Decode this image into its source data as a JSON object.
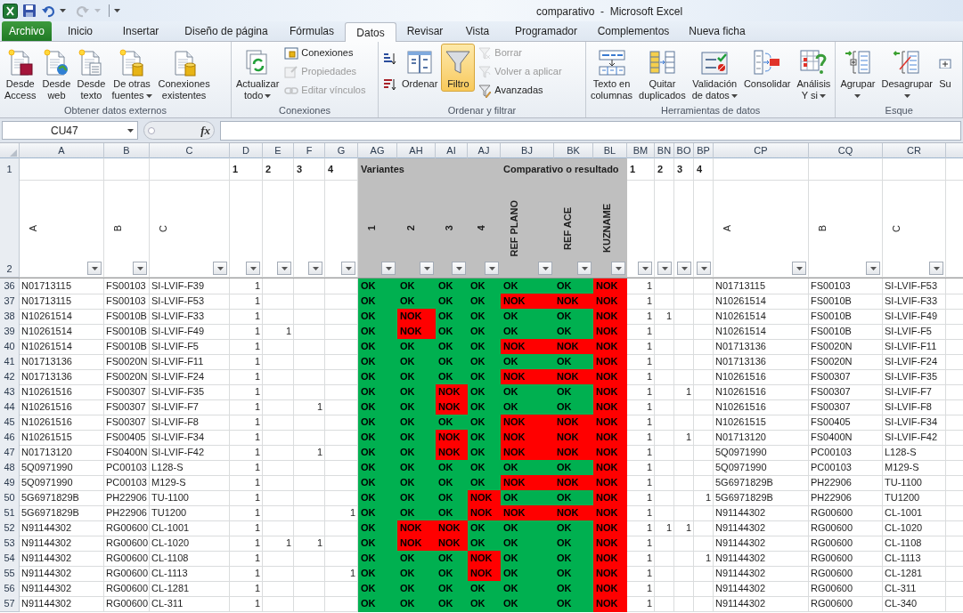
{
  "title_bar": {
    "title": "comparativo  -  Microsoft Excel"
  },
  "ribbon": {
    "tabs": [
      {
        "label": "Archivo",
        "kind": "file",
        "selected": false
      },
      {
        "label": "Inicio",
        "kind": "tab",
        "selected": false
      },
      {
        "label": "Insertar",
        "kind": "tab",
        "selected": false
      },
      {
        "label": "Diseño de página",
        "kind": "tab",
        "selected": false
      },
      {
        "label": "Fórmulas",
        "kind": "tab",
        "selected": false
      },
      {
        "label": "Datos",
        "kind": "tab",
        "selected": true
      },
      {
        "label": "Revisar",
        "kind": "tab",
        "selected": false
      },
      {
        "label": "Vista",
        "kind": "tab",
        "selected": false
      },
      {
        "label": "Programador",
        "kind": "tab",
        "selected": false
      },
      {
        "label": "Complementos",
        "kind": "tab",
        "selected": false
      },
      {
        "label": "Nueva ficha",
        "kind": "tab",
        "selected": false
      }
    ],
    "groups": [
      {
        "label": "Obtener datos externos",
        "commands": [
          {
            "kind": "large",
            "lines": [
              "Desde",
              "Access"
            ],
            "dropdown": false,
            "disabled": false,
            "on": false
          },
          {
            "kind": "large",
            "lines": [
              "Desde",
              "web"
            ],
            "dropdown": false,
            "disabled": false,
            "on": false
          },
          {
            "kind": "large",
            "lines": [
              "Desde",
              "texto"
            ],
            "dropdown": false,
            "disabled": false,
            "on": false
          },
          {
            "kind": "large",
            "lines": [
              "De otras",
              "fuentes"
            ],
            "dropdown": true,
            "disabled": false,
            "on": false
          },
          {
            "kind": "large",
            "lines": [
              "Conexiones",
              "existentes"
            ],
            "dropdown": false,
            "disabled": false,
            "on": false
          }
        ]
      },
      {
        "label": "Conexiones",
        "commands": [
          {
            "kind": "large",
            "lines": [
              "Actualizar",
              "todo"
            ],
            "dropdown": true,
            "disabled": false,
            "on": false
          },
          {
            "kind": "small",
            "lines": [
              "Conexiones"
            ],
            "dropdown": false,
            "disabled": false,
            "on": false
          },
          {
            "kind": "small",
            "lines": [
              "Propiedades"
            ],
            "dropdown": false,
            "disabled": true,
            "on": false
          },
          {
            "kind": "small",
            "lines": [
              "Editar vínculos"
            ],
            "dropdown": false,
            "disabled": true,
            "on": false
          }
        ]
      },
      {
        "label": "Ordenar y filtrar",
        "commands": [
          {
            "kind": "icon",
            "dropdown": false,
            "disabled": false,
            "on": false
          },
          {
            "kind": "icon",
            "dropdown": false,
            "disabled": false,
            "on": false
          },
          {
            "kind": "large",
            "lines": [
              "Ordenar"
            ],
            "dropdown": false,
            "disabled": false,
            "on": false
          },
          {
            "kind": "large",
            "lines": [
              "Filtro"
            ],
            "dropdown": false,
            "disabled": false,
            "on": true
          },
          {
            "kind": "small",
            "lines": [
              "Borrar"
            ],
            "dropdown": false,
            "disabled": true,
            "on": false
          },
          {
            "kind": "small",
            "lines": [
              "Volver a aplicar"
            ],
            "dropdown": false,
            "disabled": true,
            "on": false
          },
          {
            "kind": "small",
            "lines": [
              "Avanzadas"
            ],
            "dropdown": false,
            "disabled": false,
            "on": false
          }
        ]
      },
      {
        "label": "Herramientas de datos",
        "commands": [
          {
            "kind": "large",
            "lines": [
              "Texto en",
              "columnas"
            ],
            "dropdown": false,
            "disabled": false,
            "on": false
          },
          {
            "kind": "large",
            "lines": [
              "Quitar",
              "duplicados"
            ],
            "dropdown": false,
            "disabled": false,
            "on": false
          },
          {
            "kind": "large",
            "lines": [
              "Validación",
              "de datos"
            ],
            "dropdown": true,
            "disabled": false,
            "on": false
          },
          {
            "kind": "large",
            "lines": [
              "Consolidar"
            ],
            "dropdown": false,
            "disabled": false,
            "on": false
          },
          {
            "kind": "large",
            "lines": [
              "Análisis",
              "Y si"
            ],
            "dropdown": true,
            "disabled": false,
            "on": false
          }
        ]
      },
      {
        "label": "Esque",
        "commands": [
          {
            "kind": "large",
            "lines": [
              "Agrupar"
            ],
            "dropdown": true,
            "disabled": false,
            "on": false
          },
          {
            "kind": "large",
            "lines": [
              "Desagrupar"
            ],
            "dropdown": true,
            "disabled": false,
            "on": false
          },
          {
            "kind": "large",
            "lines": [
              "Su"
            ],
            "dropdown": false,
            "disabled": false,
            "on": false
          }
        ]
      }
    ]
  },
  "formula_bar": {
    "name_box": "CU47",
    "function_button": "fx"
  },
  "sheet": {
    "row1": "1",
    "row2": "2",
    "columns": [
      {
        "letter": "A",
        "label": "A",
        "shaded": false
      },
      {
        "letter": "B",
        "label": "B",
        "shaded": false
      },
      {
        "letter": "C",
        "label": "C",
        "shaded": false
      },
      {
        "letter": "D",
        "group": "1",
        "shaded": false
      },
      {
        "letter": "E",
        "group": "2",
        "shaded": false
      },
      {
        "letter": "F",
        "group": "3",
        "shaded": false
      },
      {
        "letter": "G",
        "group": "4",
        "shaded": false
      },
      {
        "letter": "AG",
        "group": "Variantes",
        "label": "1",
        "shaded": true
      },
      {
        "letter": "AH",
        "label": "2",
        "shaded": true
      },
      {
        "letter": "AI",
        "label": "3",
        "shaded": true
      },
      {
        "letter": "AJ",
        "label": "4",
        "shaded": true
      },
      {
        "letter": "BJ",
        "group": "Comparativo o resultado",
        "label": "REF PLANO",
        "shaded": true
      },
      {
        "letter": "BK",
        "label": "REF ACE",
        "shaded": true
      },
      {
        "letter": "BL",
        "label": "KUZNAME",
        "shaded": true
      },
      {
        "letter": "BM",
        "group": "1",
        "shaded": false
      },
      {
        "letter": "BN",
        "group": "2",
        "shaded": false
      },
      {
        "letter": "BO",
        "group": "3",
        "shaded": false
      },
      {
        "letter": "BP",
        "group": "4",
        "shaded": false
      },
      {
        "letter": "CP",
        "label": "A",
        "shaded": false
      },
      {
        "letter": "CQ",
        "label": "B",
        "shaded": false
      },
      {
        "letter": "CR",
        "label": "C",
        "shaded": false
      }
    ],
    "rows": [
      {
        "num": "36",
        "a": "N01713115",
        "b": "FS00103",
        "c": "SI-LVIF-F39",
        "d": "1",
        "ag": {
          "text": "OK",
          "color": "#00b050"
        },
        "ah": {
          "text": "OK",
          "color": "#00b050"
        },
        "ai": {
          "text": "OK",
          "color": "#00b050"
        },
        "aj": {
          "text": "OK",
          "color": "#00b050"
        },
        "bj": {
          "text": "OK",
          "color": "#00b050"
        },
        "bk": {
          "text": "OK",
          "color": "#00b050"
        },
        "bl": {
          "text": "NOK",
          "color": "#ff0000"
        },
        "bm": "1",
        "cp": "N01713115",
        "cq": "FS00103",
        "cr": "SI-LVIF-F53"
      },
      {
        "num": "37",
        "a": "N01713115",
        "b": "FS00103",
        "c": "SI-LVIF-F53",
        "d": "1",
        "ag": {
          "text": "OK",
          "color": "#00b050"
        },
        "ah": {
          "text": "OK",
          "color": "#00b050"
        },
        "ai": {
          "text": "OK",
          "color": "#00b050"
        },
        "aj": {
          "text": "OK",
          "color": "#00b050"
        },
        "bj": {
          "text": "NOK",
          "color": "#ff0000"
        },
        "bk": {
          "text": "NOK",
          "color": "#ff0000"
        },
        "bl": {
          "text": "NOK",
          "color": "#ff0000"
        },
        "bm": "1",
        "cp": "N10261514",
        "cq": "FS0010B",
        "cr": "SI-LVIF-F33"
      },
      {
        "num": "38",
        "a": "N10261514",
        "b": "FS0010B",
        "c": "SI-LVIF-F33",
        "d": "1",
        "ag": {
          "text": "OK",
          "color": "#00b050"
        },
        "ah": {
          "text": "NOK",
          "color": "#ff0000"
        },
        "ai": {
          "text": "OK",
          "color": "#00b050"
        },
        "aj": {
          "text": "OK",
          "color": "#00b050"
        },
        "bj": {
          "text": "OK",
          "color": "#00b050"
        },
        "bk": {
          "text": "OK",
          "color": "#00b050"
        },
        "bl": {
          "text": "NOK",
          "color": "#ff0000"
        },
        "bm": "1",
        "bn": "1",
        "cp": "N10261514",
        "cq": "FS0010B",
        "cr": "SI-LVIF-F49"
      },
      {
        "num": "39",
        "a": "N10261514",
        "b": "FS0010B",
        "c": "SI-LVIF-F49",
        "d": "1",
        "e": "1",
        "ag": {
          "text": "OK",
          "color": "#00b050"
        },
        "ah": {
          "text": "NOK",
          "color": "#ff0000"
        },
        "ai": {
          "text": "OK",
          "color": "#00b050"
        },
        "aj": {
          "text": "OK",
          "color": "#00b050"
        },
        "bj": {
          "text": "OK",
          "color": "#00b050"
        },
        "bk": {
          "text": "OK",
          "color": "#00b050"
        },
        "bl": {
          "text": "NOK",
          "color": "#ff0000"
        },
        "bm": "1",
        "cp": "N10261514",
        "cq": "FS0010B",
        "cr": "SI-LVIF-F5"
      },
      {
        "num": "40",
        "a": "N10261514",
        "b": "FS0010B",
        "c": "SI-LVIF-F5",
        "d": "1",
        "ag": {
          "text": "OK",
          "color": "#00b050"
        },
        "ah": {
          "text": "OK",
          "color": "#00b050"
        },
        "ai": {
          "text": "OK",
          "color": "#00b050"
        },
        "aj": {
          "text": "OK",
          "color": "#00b050"
        },
        "bj": {
          "text": "NOK",
          "color": "#ff0000"
        },
        "bk": {
          "text": "NOK",
          "color": "#ff0000"
        },
        "bl": {
          "text": "NOK",
          "color": "#ff0000"
        },
        "bm": "1",
        "cp": "N01713136",
        "cq": "FS0020N",
        "cr": "SI-LVIF-F11"
      },
      {
        "num": "41",
        "a": "N01713136",
        "b": "FS0020N",
        "c": "SI-LVIF-F11",
        "d": "1",
        "ag": {
          "text": "OK",
          "color": "#00b050"
        },
        "ah": {
          "text": "OK",
          "color": "#00b050"
        },
        "ai": {
          "text": "OK",
          "color": "#00b050"
        },
        "aj": {
          "text": "OK",
          "color": "#00b050"
        },
        "bj": {
          "text": "OK",
          "color": "#00b050"
        },
        "bk": {
          "text": "OK",
          "color": "#00b050"
        },
        "bl": {
          "text": "NOK",
          "color": "#ff0000"
        },
        "bm": "1",
        "cp": "N01713136",
        "cq": "FS0020N",
        "cr": "SI-LVIF-F24"
      },
      {
        "num": "42",
        "a": "N01713136",
        "b": "FS0020N",
        "c": "SI-LVIF-F24",
        "d": "1",
        "ag": {
          "text": "OK",
          "color": "#00b050"
        },
        "ah": {
          "text": "OK",
          "color": "#00b050"
        },
        "ai": {
          "text": "OK",
          "color": "#00b050"
        },
        "aj": {
          "text": "OK",
          "color": "#00b050"
        },
        "bj": {
          "text": "NOK",
          "color": "#ff0000"
        },
        "bk": {
          "text": "NOK",
          "color": "#ff0000"
        },
        "bl": {
          "text": "NOK",
          "color": "#ff0000"
        },
        "bm": "1",
        "cp": "N10261516",
        "cq": "FS00307",
        "cr": "SI-LVIF-F35"
      },
      {
        "num": "43",
        "a": "N10261516",
        "b": "FS00307",
        "c": "SI-LVIF-F35",
        "d": "1",
        "ag": {
          "text": "OK",
          "color": "#00b050"
        },
        "ah": {
          "text": "OK",
          "color": "#00b050"
        },
        "ai": {
          "text": "NOK",
          "color": "#ff0000"
        },
        "aj": {
          "text": "OK",
          "color": "#00b050"
        },
        "bj": {
          "text": "OK",
          "color": "#00b050"
        },
        "bk": {
          "text": "OK",
          "color": "#00b050"
        },
        "bl": {
          "text": "NOK",
          "color": "#ff0000"
        },
        "bm": "1",
        "bo": "1",
        "cp": "N10261516",
        "cq": "FS00307",
        "cr": "SI-LVIF-F7"
      },
      {
        "num": "44",
        "a": "N10261516",
        "b": "FS00307",
        "c": "SI-LVIF-F7",
        "d": "1",
        "f": "1",
        "ag": {
          "text": "OK",
          "color": "#00b050"
        },
        "ah": {
          "text": "OK",
          "color": "#00b050"
        },
        "ai": {
          "text": "NOK",
          "color": "#ff0000"
        },
        "aj": {
          "text": "OK",
          "color": "#00b050"
        },
        "bj": {
          "text": "OK",
          "color": "#00b050"
        },
        "bk": {
          "text": "OK",
          "color": "#00b050"
        },
        "bl": {
          "text": "NOK",
          "color": "#ff0000"
        },
        "bm": "1",
        "cp": "N10261516",
        "cq": "FS00307",
        "cr": "SI-LVIF-F8"
      },
      {
        "num": "45",
        "a": "N10261516",
        "b": "FS00307",
        "c": "SI-LVIF-F8",
        "d": "1",
        "ag": {
          "text": "OK",
          "color": "#00b050"
        },
        "ah": {
          "text": "OK",
          "color": "#00b050"
        },
        "ai": {
          "text": "OK",
          "color": "#00b050"
        },
        "aj": {
          "text": "OK",
          "color": "#00b050"
        },
        "bj": {
          "text": "NOK",
          "color": "#ff0000"
        },
        "bk": {
          "text": "NOK",
          "color": "#ff0000"
        },
        "bl": {
          "text": "NOK",
          "color": "#ff0000"
        },
        "bm": "1",
        "cp": "N10261515",
        "cq": "FS00405",
        "cr": "SI-LVIF-F34"
      },
      {
        "num": "46",
        "a": "N10261515",
        "b": "FS00405",
        "c": "SI-LVIF-F34",
        "d": "1",
        "ag": {
          "text": "OK",
          "color": "#00b050"
        },
        "ah": {
          "text": "OK",
          "color": "#00b050"
        },
        "ai": {
          "text": "NOK",
          "color": "#ff0000"
        },
        "aj": {
          "text": "OK",
          "color": "#00b050"
        },
        "bj": {
          "text": "NOK",
          "color": "#ff0000"
        },
        "bk": {
          "text": "NOK",
          "color": "#ff0000"
        },
        "bl": {
          "text": "NOK",
          "color": "#ff0000"
        },
        "bm": "1",
        "bo": "1",
        "cp": "N01713120",
        "cq": "FS0400N",
        "cr": "SI-LVIF-F42"
      },
      {
        "num": "47",
        "a": "N01713120",
        "b": "FS0400N",
        "c": "SI-LVIF-F42",
        "d": "1",
        "f": "1",
        "ag": {
          "text": "OK",
          "color": "#00b050"
        },
        "ah": {
          "text": "OK",
          "color": "#00b050"
        },
        "ai": {
          "text": "NOK",
          "color": "#ff0000"
        },
        "aj": {
          "text": "OK",
          "color": "#00b050"
        },
        "bj": {
          "text": "NOK",
          "color": "#ff0000"
        },
        "bk": {
          "text": "NOK",
          "color": "#ff0000"
        },
        "bl": {
          "text": "NOK",
          "color": "#ff0000"
        },
        "bm": "1",
        "cp": "5Q0971990",
        "cq": "PC00103",
        "cr": "L128-S"
      },
      {
        "num": "48",
        "a": "5Q0971990",
        "b": "PC00103",
        "c": "L128-S",
        "d": "1",
        "ag": {
          "text": "OK",
          "color": "#00b050"
        },
        "ah": {
          "text": "OK",
          "color": "#00b050"
        },
        "ai": {
          "text": "OK",
          "color": "#00b050"
        },
        "aj": {
          "text": "OK",
          "color": "#00b050"
        },
        "bj": {
          "text": "OK",
          "color": "#00b050"
        },
        "bk": {
          "text": "OK",
          "color": "#00b050"
        },
        "bl": {
          "text": "NOK",
          "color": "#ff0000"
        },
        "bm": "1",
        "cp": "5Q0971990",
        "cq": "PC00103",
        "cr": "M129-S"
      },
      {
        "num": "49",
        "a": "5Q0971990",
        "b": "PC00103",
        "c": "M129-S",
        "d": "1",
        "ag": {
          "text": "OK",
          "color": "#00b050"
        },
        "ah": {
          "text": "OK",
          "color": "#00b050"
        },
        "ai": {
          "text": "OK",
          "color": "#00b050"
        },
        "aj": {
          "text": "OK",
          "color": "#00b050"
        },
        "bj": {
          "text": "NOK",
          "color": "#ff0000"
        },
        "bk": {
          "text": "NOK",
          "color": "#ff0000"
        },
        "bl": {
          "text": "NOK",
          "color": "#ff0000"
        },
        "bm": "1",
        "cp": "5G6971829B",
        "cq": "PH22906",
        "cr": "TU-1100"
      },
      {
        "num": "50",
        "a": "5G6971829B",
        "b": "PH22906",
        "c": "TU-1100",
        "d": "1",
        "ag": {
          "text": "OK",
          "color": "#00b050"
        },
        "ah": {
          "text": "OK",
          "color": "#00b050"
        },
        "ai": {
          "text": "OK",
          "color": "#00b050"
        },
        "aj": {
          "text": "NOK",
          "color": "#ff0000"
        },
        "bj": {
          "text": "OK",
          "color": "#00b050"
        },
        "bk": {
          "text": "OK",
          "color": "#00b050"
        },
        "bl": {
          "text": "NOK",
          "color": "#ff0000"
        },
        "bm": "1",
        "bp": "1",
        "cp": "5G6971829B",
        "cq": "PH22906",
        "cr": "TU1200"
      },
      {
        "num": "51",
        "a": "5G6971829B",
        "b": "PH22906",
        "c": "TU1200",
        "d": "1",
        "g": "1",
        "ag": {
          "text": "OK",
          "color": "#00b050"
        },
        "ah": {
          "text": "OK",
          "color": "#00b050"
        },
        "ai": {
          "text": "OK",
          "color": "#00b050"
        },
        "aj": {
          "text": "NOK",
          "color": "#ff0000"
        },
        "bj": {
          "text": "NOK",
          "color": "#ff0000"
        },
        "bk": {
          "text": "NOK",
          "color": "#ff0000"
        },
        "bl": {
          "text": "NOK",
          "color": "#ff0000"
        },
        "bm": "1",
        "cp": "N91144302",
        "cq": "RG00600",
        "cr": "CL-1001"
      },
      {
        "num": "52",
        "a": "N91144302",
        "b": "RG00600",
        "c": "CL-1001",
        "d": "1",
        "ag": {
          "text": "OK",
          "color": "#00b050"
        },
        "ah": {
          "text": "NOK",
          "color": "#ff0000"
        },
        "ai": {
          "text": "NOK",
          "color": "#ff0000"
        },
        "aj": {
          "text": "OK",
          "color": "#00b050"
        },
        "bj": {
          "text": "OK",
          "color": "#00b050"
        },
        "bk": {
          "text": "OK",
          "color": "#00b050"
        },
        "bl": {
          "text": "NOK",
          "color": "#ff0000"
        },
        "bm": "1",
        "bn": "1",
        "bo": "1",
        "cp": "N91144302",
        "cq": "RG00600",
        "cr": "CL-1020"
      },
      {
        "num": "53",
        "a": "N91144302",
        "b": "RG00600",
        "c": "CL-1020",
        "d": "1",
        "e": "1",
        "f": "1",
        "ag": {
          "text": "OK",
          "color": "#00b050"
        },
        "ah": {
          "text": "NOK",
          "color": "#ff0000"
        },
        "ai": {
          "text": "NOK",
          "color": "#ff0000"
        },
        "aj": {
          "text": "OK",
          "color": "#00b050"
        },
        "bj": {
          "text": "OK",
          "color": "#00b050"
        },
        "bk": {
          "text": "OK",
          "color": "#00b050"
        },
        "bl": {
          "text": "NOK",
          "color": "#ff0000"
        },
        "bm": "1",
        "cp": "N91144302",
        "cq": "RG00600",
        "cr": "CL-1108"
      },
      {
        "num": "54",
        "a": "N91144302",
        "b": "RG00600",
        "c": "CL-1108",
        "d": "1",
        "ag": {
          "text": "OK",
          "color": "#00b050"
        },
        "ah": {
          "text": "OK",
          "color": "#00b050"
        },
        "ai": {
          "text": "OK",
          "color": "#00b050"
        },
        "aj": {
          "text": "NOK",
          "color": "#ff0000"
        },
        "bj": {
          "text": "OK",
          "color": "#00b050"
        },
        "bk": {
          "text": "OK",
          "color": "#00b050"
        },
        "bl": {
          "text": "NOK",
          "color": "#ff0000"
        },
        "bm": "1",
        "bp": "1",
        "cp": "N91144302",
        "cq": "RG00600",
        "cr": "CL-1113"
      },
      {
        "num": "55",
        "a": "N91144302",
        "b": "RG00600",
        "c": "CL-1113",
        "d": "1",
        "g": "1",
        "ag": {
          "text": "OK",
          "color": "#00b050"
        },
        "ah": {
          "text": "OK",
          "color": "#00b050"
        },
        "ai": {
          "text": "OK",
          "color": "#00b050"
        },
        "aj": {
          "text": "NOK",
          "color": "#ff0000"
        },
        "bj": {
          "text": "OK",
          "color": "#00b050"
        },
        "bk": {
          "text": "OK",
          "color": "#00b050"
        },
        "bl": {
          "text": "NOK",
          "color": "#ff0000"
        },
        "bm": "1",
        "cp": "N91144302",
        "cq": "RG00600",
        "cr": "CL-1281"
      },
      {
        "num": "56",
        "a": "N91144302",
        "b": "RG00600",
        "c": "CL-1281",
        "d": "1",
        "ag": {
          "text": "OK",
          "color": "#00b050"
        },
        "ah": {
          "text": "OK",
          "color": "#00b050"
        },
        "ai": {
          "text": "OK",
          "color": "#00b050"
        },
        "aj": {
          "text": "OK",
          "color": "#00b050"
        },
        "bj": {
          "text": "OK",
          "color": "#00b050"
        },
        "bk": {
          "text": "OK",
          "color": "#00b050"
        },
        "bl": {
          "text": "NOK",
          "color": "#ff0000"
        },
        "bm": "1",
        "cp": "N91144302",
        "cq": "RG00600",
        "cr": "CL-311"
      },
      {
        "num": "57",
        "a": "N91144302",
        "b": "RG00600",
        "c": "CL-311",
        "d": "1",
        "ag": {
          "text": "OK",
          "color": "#00b050"
        },
        "ah": {
          "text": "OK",
          "color": "#00b050"
        },
        "ai": {
          "text": "OK",
          "color": "#00b050"
        },
        "aj": {
          "text": "OK",
          "color": "#00b050"
        },
        "bj": {
          "text": "OK",
          "color": "#00b050"
        },
        "bk": {
          "text": "OK",
          "color": "#00b050"
        },
        "bl": {
          "text": "NOK",
          "color": "#ff0000"
        },
        "bm": "1",
        "cp": "N91144302",
        "cq": "RG00600",
        "cr": "CL-340"
      }
    ]
  }
}
